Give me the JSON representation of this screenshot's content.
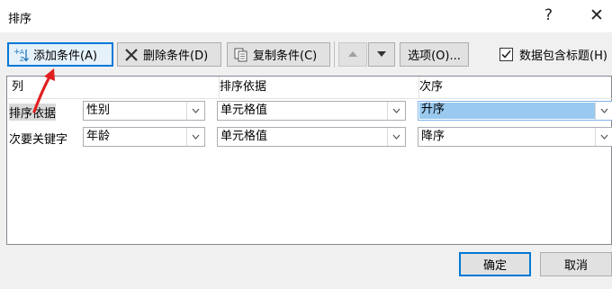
{
  "dialog": {
    "title": "排序",
    "help_glyph": "?",
    "close_glyph": "✕"
  },
  "toolbar": {
    "add_label": "添加条件(A)",
    "delete_label": "删除条件(D)",
    "copy_label": "复制条件(C)",
    "options_label": "选项(O)...",
    "header_checkbox_label": "数据包含标题(H)",
    "header_checkbox_checked": true
  },
  "grid": {
    "headers": {
      "column": "列",
      "basis": "排序依据",
      "order": "次序"
    },
    "rows": [
      {
        "label": "排序依据",
        "column": "性别",
        "basis": "单元格值",
        "order": "升序"
      },
      {
        "label": "次要关键字",
        "column": "年龄",
        "basis": "单元格值",
        "order": "降序"
      }
    ]
  },
  "footer": {
    "ok_label": "确定",
    "cancel_label": "取消"
  },
  "colors": {
    "annotation_arrow": "#e02020",
    "selection_highlight": "#99c9ef",
    "focus_border": "#0078d7"
  },
  "icons": [
    "add-condition-icon",
    "delete-x-icon",
    "copy-icon",
    "up-arrow-icon",
    "down-arrow-icon",
    "dropdown-arrow-icon",
    "check-icon",
    "red-annotation-arrow"
  ]
}
